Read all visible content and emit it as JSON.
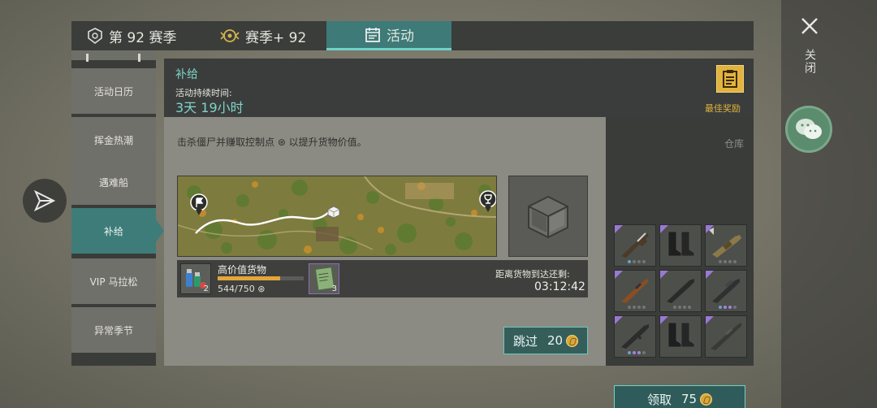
{
  "close": {
    "label": "关闭"
  },
  "tabs": [
    {
      "label": "第 92 赛季",
      "icon": "season-badge-icon"
    },
    {
      "label": "赛季+ 92",
      "icon": "season-plus-badge-icon"
    },
    {
      "label": "活动",
      "icon": "calendar-icon"
    }
  ],
  "sidebar": {
    "items": [
      {
        "label": "活动日历"
      },
      {
        "label": "挥金热潮"
      },
      {
        "label": "遇难船"
      },
      {
        "label": "补给",
        "active": true
      },
      {
        "label": "VIP 马拉松"
      },
      {
        "label": "异常季节"
      }
    ]
  },
  "main": {
    "title": "补给",
    "duration_label": "活动持续时间:",
    "duration_value": "3天 19小时",
    "best_reward_label": "最佳奖励",
    "description": "击杀僵尸并赚取控制点 ⊛ 以提升货物价值。",
    "cargo": {
      "name": "高价值货物",
      "icon_count": "2",
      "progress": 0.725,
      "progress_text": "544/750 ⊛",
      "notebook_count": "3"
    },
    "arrive_label": "距离货物到达还剩:",
    "arrive_time": "03:12:42",
    "skip_label": "跳过",
    "skip_cost": "20"
  },
  "warehouse": {
    "label": "仓库",
    "claim_label": "领取",
    "claim_cost": "75",
    "items": [
      {
        "name": "assault-rifle-ak-icon",
        "rarity": "purple"
      },
      {
        "name": "combat-boots-icon",
        "rarity": "purple"
      },
      {
        "name": "grenade-launcher-icon",
        "rarity": "purple"
      },
      {
        "name": "assault-rifle-wood-icon",
        "rarity": "purple"
      },
      {
        "name": "assault-rifle-black-icon",
        "rarity": "purple"
      },
      {
        "name": "assault-rifle-scope-icon",
        "rarity": "purple"
      },
      {
        "name": "assault-rifle-tactical-icon",
        "rarity": "purple"
      },
      {
        "name": "combat-boots-icon",
        "rarity": "purple"
      },
      {
        "name": "sniper-rifle-icon",
        "rarity": "purple"
      }
    ]
  },
  "colors": {
    "accent": "#6fd2c9",
    "panel": "#3a3d3b",
    "gold": "#e2b33e",
    "rare": "#9a78d6"
  }
}
